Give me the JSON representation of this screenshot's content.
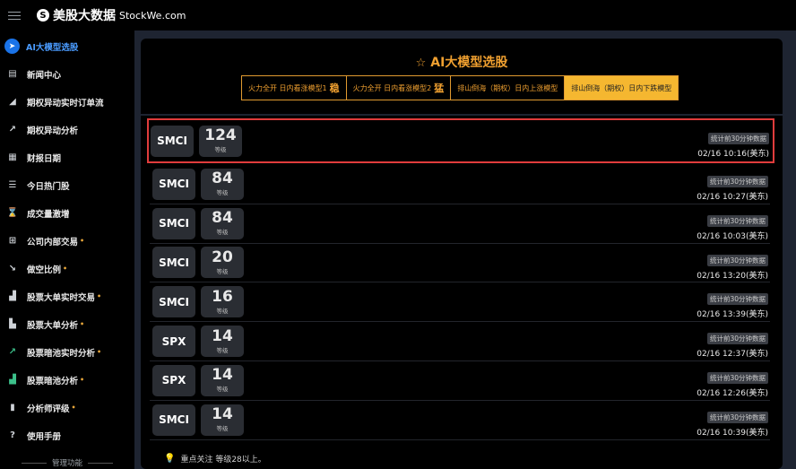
{
  "brand": {
    "icon": "S",
    "name_cn": "美股大数据",
    "name_en": "StockWe.com"
  },
  "sidebar": {
    "items": [
      {
        "label": "AI大模型选股",
        "icon": "rocket-icon",
        "glyph": "➤",
        "active": true,
        "dot": false
      },
      {
        "label": "新闻中心",
        "icon": "news-icon",
        "glyph": "▤",
        "dot": false
      },
      {
        "label": "期权异动实时订单流",
        "icon": "area-chart-icon",
        "glyph": "◢",
        "dot": false
      },
      {
        "label": "期权异动分析",
        "icon": "line-chart-icon",
        "glyph": "↗",
        "dot": false
      },
      {
        "label": "财报日期",
        "icon": "calendar-icon",
        "glyph": "▦",
        "dot": false
      },
      {
        "label": "今日热门股",
        "icon": "list-icon",
        "glyph": "☰",
        "dot": false
      },
      {
        "label": "成交量激增",
        "icon": "hourglass-icon",
        "glyph": "⌛",
        "dot": false
      },
      {
        "label": "公司内部交易",
        "icon": "sitemap-icon",
        "glyph": "⊞",
        "dot": true
      },
      {
        "label": "做空比例",
        "icon": "trend-down-icon",
        "glyph": "↘",
        "dot": true
      },
      {
        "label": "股票大单实时交易",
        "icon": "industry-icon",
        "glyph": "▟",
        "dot": true
      },
      {
        "label": "股票大单分析",
        "icon": "bar-chart-icon",
        "glyph": "▙",
        "dot": true
      },
      {
        "label": "股票暗池实时分析",
        "icon": "dark-pool-live-icon",
        "glyph": "↗",
        "dot": true,
        "green": true
      },
      {
        "label": "股票暗池分析",
        "icon": "dark-pool-chart-icon",
        "glyph": "▟",
        "dot": true,
        "green": true
      },
      {
        "label": "分析师评级",
        "icon": "analyst-chart-icon",
        "glyph": "▮",
        "dot": true
      },
      {
        "label": "使用手册",
        "icon": "help-icon",
        "glyph": "?",
        "dot": false
      }
    ],
    "dot_symbol": "•",
    "manage_label": "管理功能"
  },
  "main": {
    "star_icon": "☆",
    "title": "AI大模型选股",
    "tabs": [
      {
        "label": "火力全开 日内看涨模型1",
        "badge": "稳",
        "selected": false
      },
      {
        "label": "火力全开 日内看涨模型2",
        "badge": "猛",
        "selected": false
      },
      {
        "label": "排山倒海（期权）日内上涨模型",
        "badge": "",
        "selected": false
      },
      {
        "label": "排山倒海（期权）日内下跌模型",
        "badge": "",
        "selected": true
      }
    ],
    "grade_label": "等级",
    "stat_label": "统计前30分钟数据",
    "rows": [
      {
        "symbol": "SMCI",
        "grade": "124",
        "time": "02/16 10:16(美东)",
        "highlight": true
      },
      {
        "symbol": "SMCI",
        "grade": "84",
        "time": "02/16 10:27(美东)"
      },
      {
        "symbol": "SMCI",
        "grade": "84",
        "time": "02/16 10:03(美东)"
      },
      {
        "symbol": "SMCI",
        "grade": "20",
        "time": "02/16 13:20(美东)"
      },
      {
        "symbol": "SMCI",
        "grade": "16",
        "time": "02/16 13:39(美东)"
      },
      {
        "symbol": "SPX",
        "grade": "14",
        "time": "02/16 12:37(美东)"
      },
      {
        "symbol": "SPX",
        "grade": "14",
        "time": "02/16 12:26(美东)"
      },
      {
        "symbol": "SMCI",
        "grade": "14",
        "time": "02/16 10:39(美东)"
      }
    ],
    "bulb_icon": "💡",
    "footnote": "重点关注 等级28以上。"
  }
}
